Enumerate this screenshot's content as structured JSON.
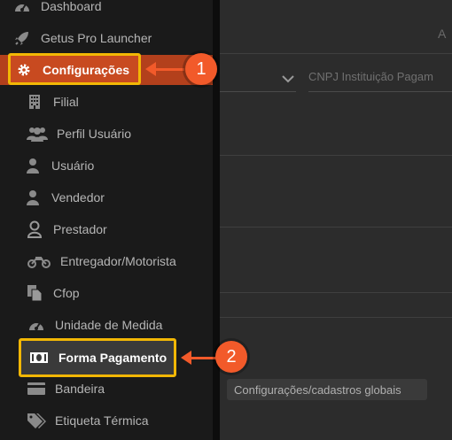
{
  "sidebar": {
    "items": [
      {
        "label": "Dashboard",
        "icon": "dashboard-icon"
      },
      {
        "label": "Getus Pro Launcher",
        "icon": "rocket-icon"
      },
      {
        "label": "Configurações",
        "icon": "gear-icon"
      },
      {
        "label": "Filial",
        "icon": "building-icon"
      },
      {
        "label": "Perfil Usuário",
        "icon": "users-icon"
      },
      {
        "label": "Usuário",
        "icon": "user-icon"
      },
      {
        "label": "Vendedor",
        "icon": "user-icon"
      },
      {
        "label": "Prestador",
        "icon": "user-outline-icon"
      },
      {
        "label": "Entregador/Motorista",
        "icon": "motorcycle-icon"
      },
      {
        "label": "Cfop",
        "icon": "copy-icon"
      },
      {
        "label": "Unidade de Medida",
        "icon": "gauge-icon"
      },
      {
        "label": "Forma Pagamento",
        "icon": "money-icon"
      },
      {
        "label": "Bandeira",
        "icon": "credit-card-icon"
      },
      {
        "label": "Etiqueta Térmica",
        "icon": "tags-icon"
      }
    ]
  },
  "main": {
    "field_placeholder": "CNPJ Instituição Pagam",
    "tooltip": "Configurações/cadastros globais",
    "corner_char": "A"
  },
  "annotations": {
    "step1": "1",
    "step2": "2"
  },
  "colors": {
    "accent": "#f25a2a",
    "highlight_border": "#f2b705",
    "active_bg": "#b3401c"
  }
}
